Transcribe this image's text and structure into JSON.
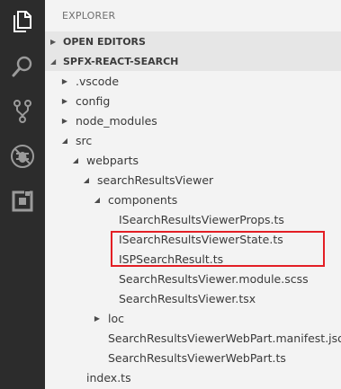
{
  "explorer": {
    "title": "EXPLORER",
    "sections": {
      "open_editors": "OPEN EDITORS",
      "project": "SPFX-REACT-SEARCH"
    },
    "tree": [
      {
        "label": ".vscode",
        "expanded": false
      },
      {
        "label": "config",
        "expanded": false
      },
      {
        "label": "node_modules",
        "expanded": false
      },
      {
        "label": "src",
        "expanded": true
      },
      {
        "label": "webparts",
        "expanded": true
      },
      {
        "label": "searchResultsViewer",
        "expanded": true
      },
      {
        "label": "components",
        "expanded": true
      },
      {
        "label": "ISearchResultsViewerProps.ts"
      },
      {
        "label": "ISearchResultsViewerState.ts",
        "highlighted": true
      },
      {
        "label": "ISPSearchResult.ts",
        "highlighted": true
      },
      {
        "label": "SearchResultsViewer.module.scss"
      },
      {
        "label": "SearchResultsViewer.tsx"
      },
      {
        "label": "loc",
        "expanded": false
      },
      {
        "label": "SearchResultsViewerWebPart.manifest.json"
      },
      {
        "label": "SearchResultsViewerWebPart.ts"
      },
      {
        "label": "index.ts"
      }
    ]
  },
  "activity_bar": {
    "icons": [
      "files-icon",
      "search-icon",
      "source-control-icon",
      "debug-icon",
      "extensions-icon"
    ]
  },
  "colors": {
    "activity_bar_bg": "#2c2c2c",
    "sidebar_bg": "#f3f3f3",
    "highlight_border": "#e31e24"
  }
}
